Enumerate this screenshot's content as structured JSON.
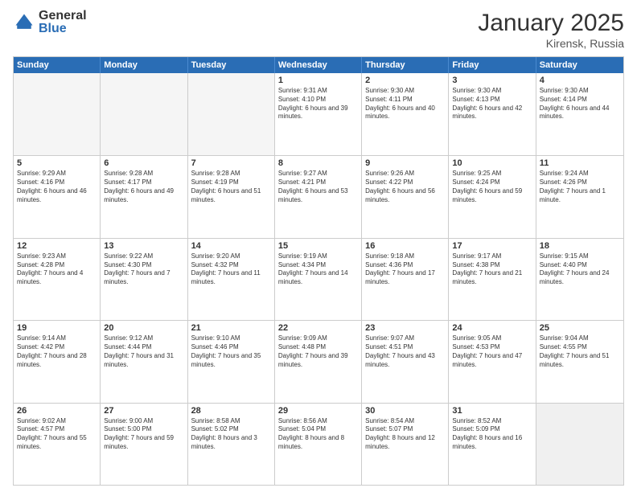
{
  "logo": {
    "general": "General",
    "blue": "Blue"
  },
  "header": {
    "month": "January 2025",
    "location": "Kirensk, Russia"
  },
  "weekdays": [
    "Sunday",
    "Monday",
    "Tuesday",
    "Wednesday",
    "Thursday",
    "Friday",
    "Saturday"
  ],
  "rows": [
    [
      {
        "day": "",
        "text": "",
        "empty": true
      },
      {
        "day": "",
        "text": "",
        "empty": true
      },
      {
        "day": "",
        "text": "",
        "empty": true
      },
      {
        "day": "1",
        "text": "Sunrise: 9:31 AM\nSunset: 4:10 PM\nDaylight: 6 hours and 39 minutes.",
        "empty": false
      },
      {
        "day": "2",
        "text": "Sunrise: 9:30 AM\nSunset: 4:11 PM\nDaylight: 6 hours and 40 minutes.",
        "empty": false
      },
      {
        "day": "3",
        "text": "Sunrise: 9:30 AM\nSunset: 4:13 PM\nDaylight: 6 hours and 42 minutes.",
        "empty": false
      },
      {
        "day": "4",
        "text": "Sunrise: 9:30 AM\nSunset: 4:14 PM\nDaylight: 6 hours and 44 minutes.",
        "empty": false
      }
    ],
    [
      {
        "day": "5",
        "text": "Sunrise: 9:29 AM\nSunset: 4:16 PM\nDaylight: 6 hours and 46 minutes.",
        "empty": false
      },
      {
        "day": "6",
        "text": "Sunrise: 9:28 AM\nSunset: 4:17 PM\nDaylight: 6 hours and 49 minutes.",
        "empty": false
      },
      {
        "day": "7",
        "text": "Sunrise: 9:28 AM\nSunset: 4:19 PM\nDaylight: 6 hours and 51 minutes.",
        "empty": false
      },
      {
        "day": "8",
        "text": "Sunrise: 9:27 AM\nSunset: 4:21 PM\nDaylight: 6 hours and 53 minutes.",
        "empty": false
      },
      {
        "day": "9",
        "text": "Sunrise: 9:26 AM\nSunset: 4:22 PM\nDaylight: 6 hours and 56 minutes.",
        "empty": false
      },
      {
        "day": "10",
        "text": "Sunrise: 9:25 AM\nSunset: 4:24 PM\nDaylight: 6 hours and 59 minutes.",
        "empty": false
      },
      {
        "day": "11",
        "text": "Sunrise: 9:24 AM\nSunset: 4:26 PM\nDaylight: 7 hours and 1 minute.",
        "empty": false
      }
    ],
    [
      {
        "day": "12",
        "text": "Sunrise: 9:23 AM\nSunset: 4:28 PM\nDaylight: 7 hours and 4 minutes.",
        "empty": false
      },
      {
        "day": "13",
        "text": "Sunrise: 9:22 AM\nSunset: 4:30 PM\nDaylight: 7 hours and 7 minutes.",
        "empty": false
      },
      {
        "day": "14",
        "text": "Sunrise: 9:20 AM\nSunset: 4:32 PM\nDaylight: 7 hours and 11 minutes.",
        "empty": false
      },
      {
        "day": "15",
        "text": "Sunrise: 9:19 AM\nSunset: 4:34 PM\nDaylight: 7 hours and 14 minutes.",
        "empty": false
      },
      {
        "day": "16",
        "text": "Sunrise: 9:18 AM\nSunset: 4:36 PM\nDaylight: 7 hours and 17 minutes.",
        "empty": false
      },
      {
        "day": "17",
        "text": "Sunrise: 9:17 AM\nSunset: 4:38 PM\nDaylight: 7 hours and 21 minutes.",
        "empty": false
      },
      {
        "day": "18",
        "text": "Sunrise: 9:15 AM\nSunset: 4:40 PM\nDaylight: 7 hours and 24 minutes.",
        "empty": false
      }
    ],
    [
      {
        "day": "19",
        "text": "Sunrise: 9:14 AM\nSunset: 4:42 PM\nDaylight: 7 hours and 28 minutes.",
        "empty": false
      },
      {
        "day": "20",
        "text": "Sunrise: 9:12 AM\nSunset: 4:44 PM\nDaylight: 7 hours and 31 minutes.",
        "empty": false
      },
      {
        "day": "21",
        "text": "Sunrise: 9:10 AM\nSunset: 4:46 PM\nDaylight: 7 hours and 35 minutes.",
        "empty": false
      },
      {
        "day": "22",
        "text": "Sunrise: 9:09 AM\nSunset: 4:48 PM\nDaylight: 7 hours and 39 minutes.",
        "empty": false
      },
      {
        "day": "23",
        "text": "Sunrise: 9:07 AM\nSunset: 4:51 PM\nDaylight: 7 hours and 43 minutes.",
        "empty": false
      },
      {
        "day": "24",
        "text": "Sunrise: 9:05 AM\nSunset: 4:53 PM\nDaylight: 7 hours and 47 minutes.",
        "empty": false
      },
      {
        "day": "25",
        "text": "Sunrise: 9:04 AM\nSunset: 4:55 PM\nDaylight: 7 hours and 51 minutes.",
        "empty": false
      }
    ],
    [
      {
        "day": "26",
        "text": "Sunrise: 9:02 AM\nSunset: 4:57 PM\nDaylight: 7 hours and 55 minutes.",
        "empty": false
      },
      {
        "day": "27",
        "text": "Sunrise: 9:00 AM\nSunset: 5:00 PM\nDaylight: 7 hours and 59 minutes.",
        "empty": false
      },
      {
        "day": "28",
        "text": "Sunrise: 8:58 AM\nSunset: 5:02 PM\nDaylight: 8 hours and 3 minutes.",
        "empty": false
      },
      {
        "day": "29",
        "text": "Sunrise: 8:56 AM\nSunset: 5:04 PM\nDaylight: 8 hours and 8 minutes.",
        "empty": false
      },
      {
        "day": "30",
        "text": "Sunrise: 8:54 AM\nSunset: 5:07 PM\nDaylight: 8 hours and 12 minutes.",
        "empty": false
      },
      {
        "day": "31",
        "text": "Sunrise: 8:52 AM\nSunset: 5:09 PM\nDaylight: 8 hours and 16 minutes.",
        "empty": false
      },
      {
        "day": "",
        "text": "",
        "empty": true,
        "shaded": true
      }
    ]
  ]
}
